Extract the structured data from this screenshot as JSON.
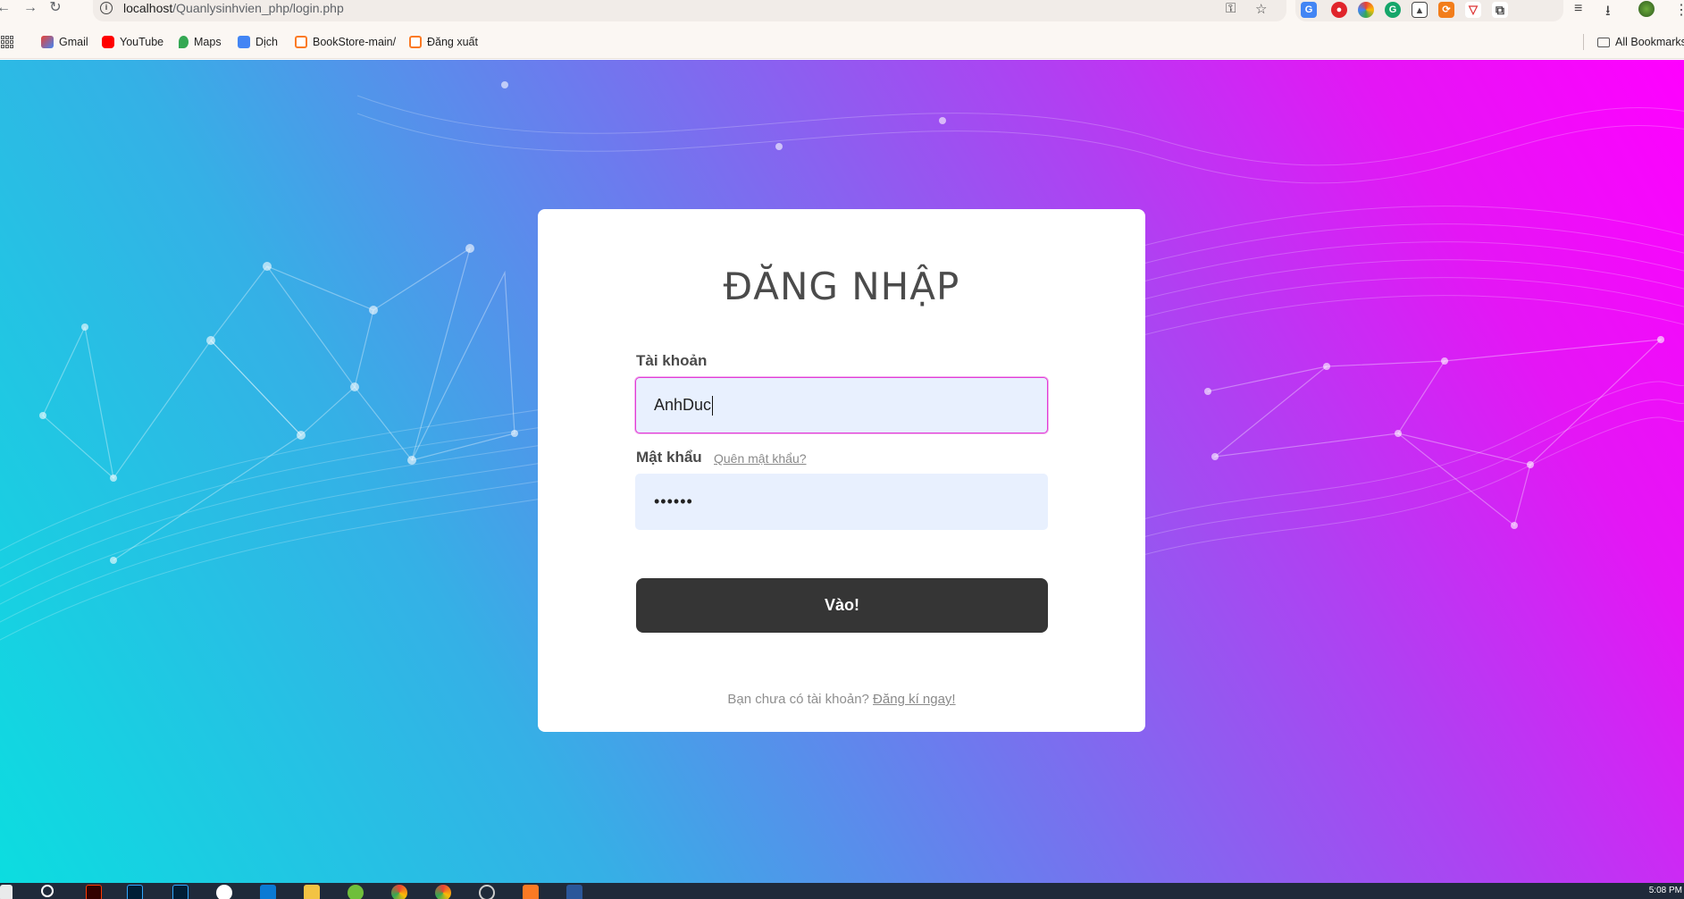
{
  "browser": {
    "url_host": "localhost",
    "url_path": "/Quanlysinhvien_php/login.php"
  },
  "bookmarks": {
    "items": [
      {
        "label": "Gmail",
        "icon": "gmail-icon",
        "color": "#ea4335"
      },
      {
        "label": "YouTube",
        "icon": "youtube-icon",
        "color": "#ff0000"
      },
      {
        "label": "Maps",
        "icon": "maps-icon",
        "color": "#34a853"
      },
      {
        "label": "Dịch",
        "icon": "translate-icon",
        "color": "#4285f4"
      },
      {
        "label": "BookStore-main/",
        "icon": "xampp-icon",
        "color": "#fb7a24"
      },
      {
        "label": "Đăng xuất",
        "icon": "xampp-icon",
        "color": "#fb7a24"
      }
    ],
    "all_bookmarks": "All Bookmarks"
  },
  "login": {
    "title": "ĐĂNG NHẬP",
    "username_label": "Tài khoản",
    "username_value": "AnhDuc",
    "password_label": "Mật khẩu",
    "forgot_link": "Quên mật khẩu?",
    "password_value": "••••••",
    "submit": "Vào!",
    "no_account": "Bạn chưa có tài khoản?",
    "register_link": "Đăng kí ngay!"
  },
  "taskbar": {
    "clock": "5:08 PM"
  },
  "colors": {
    "button": "#353535",
    "focus_border": "#e23bd6",
    "input_bg": "#e8f0fe"
  }
}
